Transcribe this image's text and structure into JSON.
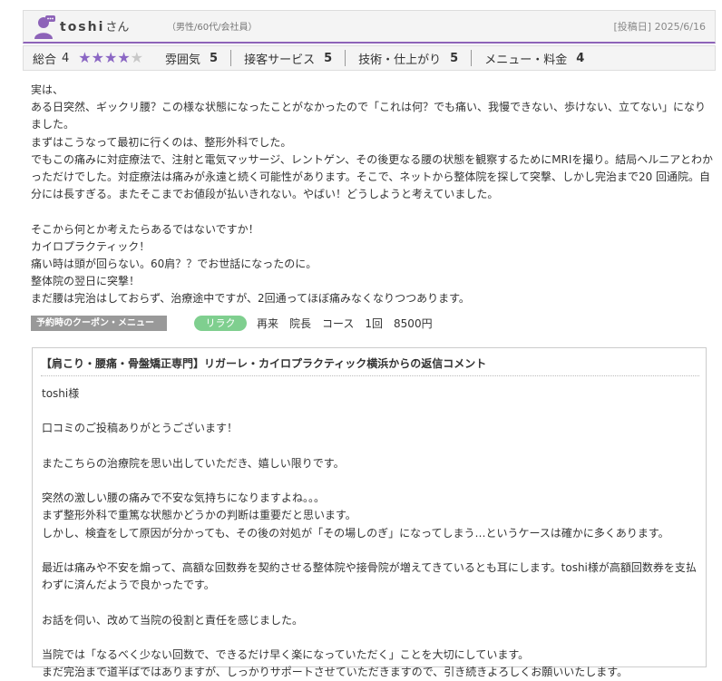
{
  "header": {
    "username": "toshi",
    "honorific": "さん",
    "user_meta": "（男性/60代/会社員）",
    "post_date": "[投稿日] 2025/6/16"
  },
  "ratings": {
    "overall_label": "総合",
    "overall_value": "4",
    "stars_filled": 4,
    "stars_total": 5,
    "star_color": "#8b67c4",
    "items": [
      {
        "label": "雰囲気",
        "value": "5"
      },
      {
        "label": "接客サービス",
        "value": "5"
      },
      {
        "label": "技術・仕上がり",
        "value": "5"
      },
      {
        "label": "メニュー・料金",
        "value": "4"
      }
    ]
  },
  "review": {
    "text": "実は、\nある日突然、ギックリ腰？この様な状態になったことがなかったので「これは何？でも痛い、我慢できない、歩けない、立てない」になりました。\nまずはこうなって最初に行くのは、整形外科でした。\nでもこの痛みに対症療法で、注射と電気マッサージ、レントゲン、その後更なる腰の状態を観察するためにMRIを撮り。結局ヘルニアとわかっただけでした。対症療法は痛みが永遠と続く可能性があります。そこで、ネットから整体院を探して突撃、しかし完治まで20 回通院。自分には長すぎる。またそこまでお値段が払いきれない。やばい！どうしようと考えていました。\n\nそこから何とか考えたらあるではないですか！\nカイロプラクティック！\n痛い時は頭が回らない。60肩？？でお世話になったのに。\n整体院の翌日に突撃！\nまだ腰は完治はしておらず、治療途中ですが、2回通ってほぼ痛みなくなりつつあります。"
  },
  "coupon": {
    "label": "予約時のクーポン・メニュー",
    "tag": "リラク",
    "text": "再来　院長　コース　1回　8500円"
  },
  "reply": {
    "title": "【肩こり・腰痛・骨盤矯正専門】リガーレ・カイロプラクティック横浜からの返信コメント",
    "text": "toshi様\n\n口コミのご投稿ありがとうございます！\n\nまたこちらの治療院を思い出していただき、嬉しい限りです。\n\n突然の激しい腰の痛みで不安な気持ちになりますよね。。。\nまず整形外科で重篤な状態かどうかの判断は重要だと思います。\nしかし、検査をして原因が分かっても、その後の対処が「その場しのぎ」になってしまう…というケースは確かに多くあります。\n\n最近は痛みや不安を煽って、高額な回数券を契約させる整体院や接骨院が増えてきているとも耳にします。toshi様が高額回数券を支払わずに済んだようで良かったです。\n\nお話を伺い、改めて当院の役割と責任を感じました。\n\n当院では「なるべく少ない回数で、できるだけ早く楽になっていただく」ことを大切にしています。\nまだ完治まで道半ばではありますが、しっかりサポートさせていただきますので、引き続きよろしくお願いいたします。"
  },
  "colors": {
    "accent": "#8d63b8",
    "tag_green": "#7fcf8f",
    "label_gray": "#999999"
  },
  "icons": {
    "avatar": "user-avatar-icon",
    "star": "star-icon"
  }
}
